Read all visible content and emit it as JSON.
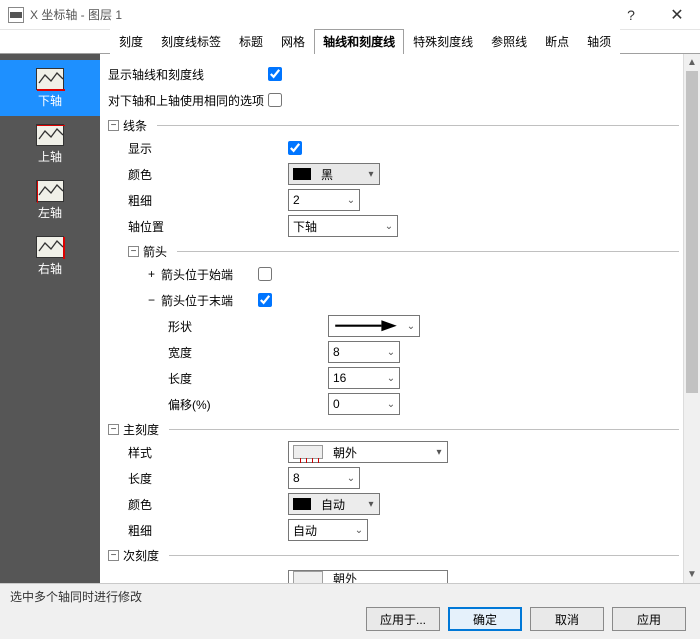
{
  "window": {
    "title": "X 坐标轴 - 图层 1",
    "help": "?",
    "close": "✕"
  },
  "tabs": [
    "刻度",
    "刻度线标签",
    "标题",
    "网格",
    "轴线和刻度线",
    "特殊刻度线",
    "参照线",
    "断点",
    "轴须"
  ],
  "active_tab": 4,
  "sidebar": {
    "items": [
      {
        "label": "下轴"
      },
      {
        "label": "上轴"
      },
      {
        "label": "左轴"
      },
      {
        "label": "右轴"
      }
    ],
    "selected": 0
  },
  "form": {
    "show_axis_ticks_label": "显示轴线和刻度线",
    "show_axis_ticks": true,
    "use_same_top_bottom_label": "对下轴和上轴使用相同的选项",
    "use_same_top_bottom": false,
    "line_group": "线条",
    "line": {
      "show_label": "显示",
      "show": true,
      "color_label": "颜色",
      "color_text": "黑",
      "thickness_label": "粗细",
      "thickness": "2",
      "position_label": "轴位置",
      "position": "下轴",
      "arrow_group": "箭头",
      "arrow_start_label": "箭头位于始端",
      "arrow_start": false,
      "arrow_end_label": "箭头位于末端",
      "arrow_end": true,
      "arrow": {
        "shape_label": "形状",
        "width_label": "宽度",
        "width": "8",
        "length_label": "长度",
        "length": "16",
        "offset_label": "偏移(%)",
        "offset": "0"
      }
    },
    "major_group": "主刻度",
    "major": {
      "style_label": "样式",
      "style_text": "朝外",
      "length_label": "长度",
      "length": "8",
      "color_label": "颜色",
      "color_text": "自动",
      "thickness_label": "粗细",
      "thickness": "自动"
    },
    "minor_group": "次刻度",
    "minor_style_text": "朝外"
  },
  "footer": {
    "hint": "选中多个轴同时进行修改",
    "apply_to": "应用于...",
    "ok": "确定",
    "cancel": "取消",
    "apply": "应用"
  },
  "glyph": {
    "minus": "−",
    "plus": "+",
    "caret_down": "▾",
    "caret_down_sm": "⌄",
    "tri_up": "▲",
    "tri_down": "▼"
  }
}
